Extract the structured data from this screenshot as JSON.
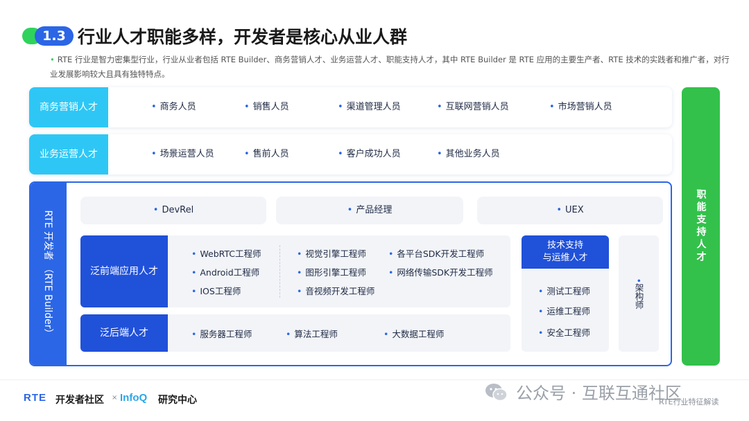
{
  "header": {
    "badge": "1.3",
    "title": "行业人才职能多样，开发者是核心从业人群",
    "description": "RTE 行业是智力密集型行业，行业从业者包括 RTE Builder、商务营销人才、业务运营人才、职能支持人才，其中 RTE Builder 是 RTE 应用的主要生产者、RTE 技术的实践者和推广者，对行业发展影响较大且具有独特特点。"
  },
  "rows": [
    {
      "label": "商务营销人才",
      "items": [
        "商务人员",
        "销售人员",
        "渠道管理人员",
        "互联网营销人员",
        "市场营销人员"
      ]
    },
    {
      "label": "业务运营人才",
      "items": [
        "场景运营人员",
        "售前人员",
        "客户成功人员",
        "其他业务人员"
      ]
    }
  ],
  "support_bar": {
    "label": "职能支持人才"
  },
  "builder": {
    "side_label": "RTE 开发者 （RTE Builder）",
    "top_roles": [
      "DevRel",
      "产品经理",
      "UEX"
    ],
    "frontend": {
      "label": "泛前端应用人才",
      "col1": [
        "WebRTC工程师",
        "Android工程师",
        "IOS工程师"
      ],
      "col2": [
        "视觉引擎工程师",
        "图形引擎工程师",
        "音视频开发工程师"
      ],
      "col3": [
        "各平台SDK开发工程师",
        "网络传输SDK开发工程师"
      ]
    },
    "backend": {
      "label": "泛后端人才",
      "items": [
        "服务器工程师",
        "算法工程师",
        "大数据工程师"
      ]
    },
    "ops": {
      "label_line1": "技术支持",
      "label_line2": "与运维人才",
      "items": [
        "测试工程师",
        "运维工程师",
        "安全工程师"
      ]
    },
    "architect": "架构师"
  },
  "footer": {
    "logo_rte": "RTE",
    "logo_dev": "开发者社区",
    "logo_x": "×",
    "logo_infoq": "InfoQ",
    "logo_research": "研究中心",
    "watermark": "公众号 · 互联互通社区",
    "caption": "RTE行业特征解读"
  },
  "colors": {
    "accent_blue": "#2b66e6",
    "deep_blue": "#2051d9",
    "cyan": "#2ec7f5",
    "green": "#33c14c"
  }
}
